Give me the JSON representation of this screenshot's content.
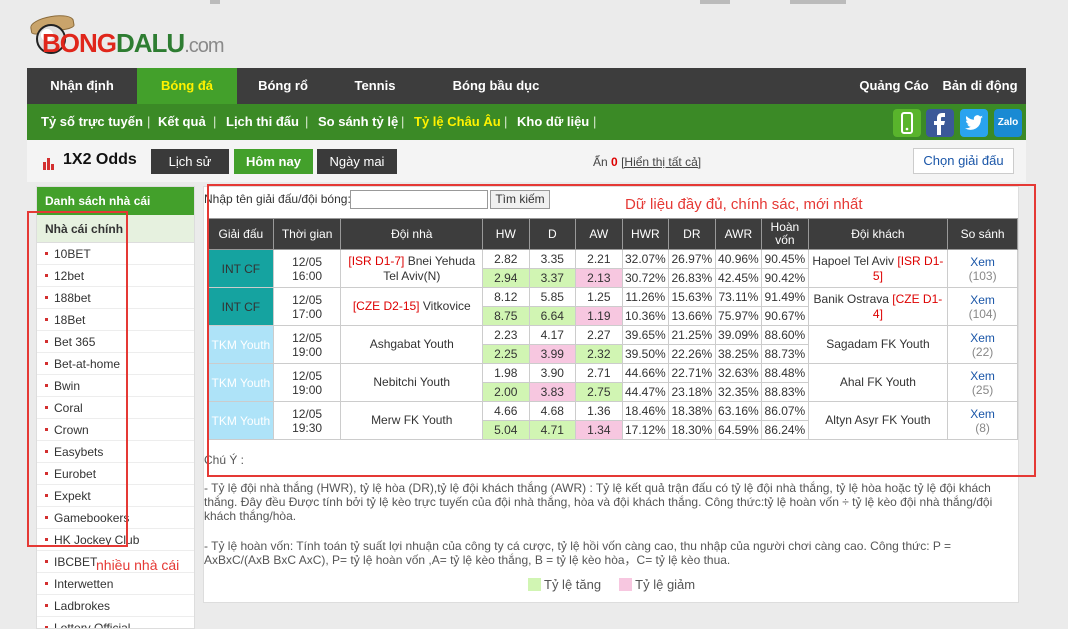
{
  "logo": {
    "part1": "BONG",
    "part2": "DALU",
    "part3": ".com"
  },
  "main_nav": [
    {
      "label": "Nhận định",
      "active": false
    },
    {
      "label": "Bóng đá",
      "active": true
    },
    {
      "label": "Bóng rổ",
      "active": false
    },
    {
      "label": "Tennis",
      "active": false
    },
    {
      "label": "Bóng bầu dục",
      "active": false
    }
  ],
  "main_nav_right": [
    "Quảng Cáo",
    "Bản di động"
  ],
  "sub_nav": [
    {
      "label": "Tỷ số trực tuyến",
      "active": false
    },
    {
      "label": "Kết quả",
      "active": false
    },
    {
      "label": "Lịch thi đấu",
      "active": false
    },
    {
      "label": "So sánh tỷ lệ",
      "active": false
    },
    {
      "label": "Tỷ lệ Châu Âu",
      "active": true
    },
    {
      "label": "Kho dữ liệu",
      "active": false
    }
  ],
  "social": {
    "zalo": "Zalo"
  },
  "page": {
    "title": "1X2 Odds",
    "tab_history": "Lịch sử",
    "tab_today": "Hôm nay",
    "tab_tomorrow": "Ngày mai",
    "hidden_prefix": "Ẩn",
    "hidden_count": "0",
    "show_all": "[Hiển thị tất cả]",
    "choose_league": "Chọn giải đấu"
  },
  "sidebar": {
    "heading": "Danh sách nhà cái",
    "subheading": "Nhà cái chính",
    "items": [
      "10BET",
      "12bet",
      "188bet",
      "18Bet",
      "Bet 365",
      "Bet-at-home",
      "Bwin",
      "Coral",
      "Crown",
      "Easybets",
      "Eurobet",
      "Expekt",
      "Gamebookers",
      "HK Jockey Club",
      "IBCBET",
      "Interwetten",
      "Ladbrokes",
      "Lottery Official"
    ]
  },
  "search": {
    "label": "Nhập tên giải đấu/đội bóng:",
    "value": "",
    "button": "Tìm kiếm"
  },
  "table": {
    "headers": [
      "Giải đấu",
      "Thời gian",
      "Đội nhà",
      "HW",
      "D",
      "AW",
      "HWR",
      "DR",
      "AWR",
      "Hoàn vốn",
      "Đội khách",
      "So sánh"
    ],
    "matches": [
      {
        "league": "INT CF",
        "league_color": "teal",
        "time": "12/05 16:00",
        "home_tag": "[ISR D1-7]",
        "home": "Bnei Yehuda Tel Aviv(N)",
        "away": "Hapoel Tel Aviv",
        "away_tag": "[ISR D1-5]",
        "compare": "Xem",
        "count": "(103)",
        "rows": [
          {
            "hw": "2.82",
            "d": "3.35",
            "aw": "2.21",
            "hwr": "32.07%",
            "dr": "26.97%",
            "awr": "40.96%",
            "payout": "90.45%",
            "hw_t": "",
            "d_t": "",
            "aw_t": ""
          },
          {
            "hw": "2.94",
            "d": "3.37",
            "aw": "2.13",
            "hwr": "30.72%",
            "dr": "26.83%",
            "awr": "42.45%",
            "payout": "90.42%",
            "hw_t": "up",
            "d_t": "up",
            "aw_t": "down"
          }
        ]
      },
      {
        "league": "INT CF",
        "league_color": "teal",
        "time": "12/05 17:00",
        "home_tag": "[CZE D2-15]",
        "home": "Vitkovice",
        "away": "Banik Ostrava",
        "away_tag": "[CZE D1-4]",
        "compare": "Xem",
        "count": "(104)",
        "rows": [
          {
            "hw": "8.12",
            "d": "5.85",
            "aw": "1.25",
            "hwr": "11.26%",
            "dr": "15.63%",
            "awr": "73.11%",
            "payout": "91.49%",
            "hw_t": "",
            "d_t": "",
            "aw_t": ""
          },
          {
            "hw": "8.75",
            "d": "6.64",
            "aw": "1.19",
            "hwr": "10.36%",
            "dr": "13.66%",
            "awr": "75.97%",
            "payout": "90.67%",
            "hw_t": "up",
            "d_t": "up",
            "aw_t": "down"
          }
        ]
      },
      {
        "league": "TKM Youth",
        "league_color": "sky",
        "time": "12/05 19:00",
        "home_tag": "",
        "home": "Ashgabat Youth",
        "away": "Sagadam FK Youth",
        "away_tag": "",
        "compare": "Xem",
        "count": "(22)",
        "rows": [
          {
            "hw": "2.23",
            "d": "4.17",
            "aw": "2.27",
            "hwr": "39.65%",
            "dr": "21.25%",
            "awr": "39.09%",
            "payout": "88.60%",
            "hw_t": "",
            "d_t": "",
            "aw_t": ""
          },
          {
            "hw": "2.25",
            "d": "3.99",
            "aw": "2.32",
            "hwr": "39.50%",
            "dr": "22.26%",
            "awr": "38.25%",
            "payout": "88.73%",
            "hw_t": "up",
            "d_t": "down",
            "aw_t": "up"
          }
        ]
      },
      {
        "league": "TKM Youth",
        "league_color": "sky",
        "time": "12/05 19:00",
        "home_tag": "",
        "home": "Nebitchi Youth",
        "away": "Ahal FK Youth",
        "away_tag": "",
        "compare": "Xem",
        "count": "(25)",
        "rows": [
          {
            "hw": "1.98",
            "d": "3.90",
            "aw": "2.71",
            "hwr": "44.66%",
            "dr": "22.71%",
            "awr": "32.63%",
            "payout": "88.48%",
            "hw_t": "",
            "d_t": "",
            "aw_t": ""
          },
          {
            "hw": "2.00",
            "d": "3.83",
            "aw": "2.75",
            "hwr": "44.47%",
            "dr": "23.18%",
            "awr": "32.35%",
            "payout": "88.83%",
            "hw_t": "up",
            "d_t": "down",
            "aw_t": "up"
          }
        ]
      },
      {
        "league": "TKM Youth",
        "league_color": "sky",
        "time": "12/05 19:30",
        "home_tag": "",
        "home": "Merw FK Youth",
        "away": "Altyn Asyr FK Youth",
        "away_tag": "",
        "compare": "Xem",
        "count": "(8)",
        "rows": [
          {
            "hw": "4.66",
            "d": "4.68",
            "aw": "1.36",
            "hwr": "18.46%",
            "dr": "18.38%",
            "awr": "63.16%",
            "payout": "86.07%",
            "hw_t": "",
            "d_t": "",
            "aw_t": ""
          },
          {
            "hw": "5.04",
            "d": "4.71",
            "aw": "1.34",
            "hwr": "17.12%",
            "dr": "18.30%",
            "awr": "64.59%",
            "payout": "86.24%",
            "hw_t": "up",
            "d_t": "up",
            "aw_t": "down"
          }
        ]
      }
    ]
  },
  "notes": {
    "title": "Chú Ý :",
    "p1": "- Tỷ lệ đội nhà thắng (HWR), tỷ lệ hòa (DR),tỷ lệ đội khách thắng (AWR) : Tỷ lệ kết quả trận đấu có tỷ lệ đội nhà thắng, tỷ lệ hòa hoặc tỷ lệ đội khách thắng. Đây đều Được tính bởi tỷ lệ kèo trực tuyến của đội nhà thắng, hòa và đội khách thắng. Công thức:tỷ lệ hoàn vốn ÷ tỷ lệ kèo đội nhà thắng/đội khách thắng/hòa.",
    "p2": "- Tỷ lệ hoàn vốn: Tính toán tỷ suất lợi nhuận của công ty cá cược, tỷ lệ hồi vốn càng cao, thu nhập của người chơi càng cao. Công thức: P = AxBxC/(AxB BxC AxC), P= tỷ lệ hoàn vốn ,A= tỷ lệ kèo thắng, B = tỷ lệ kèo hòa，C= tỷ lệ kèo thua.",
    "legend_up": "Tỷ lệ tăng",
    "legend_down": "Tỷ lệ giảm"
  },
  "annotations": {
    "top_right": "Dữ liệu đầy đủ, chính sác, mới nhất",
    "sidebar": "nhiều nhà cái"
  },
  "colors": {
    "up": "#d1f5b3",
    "down": "#f7c7e0",
    "accent_green": "#43a02b",
    "annotation_red": "#e53935"
  }
}
